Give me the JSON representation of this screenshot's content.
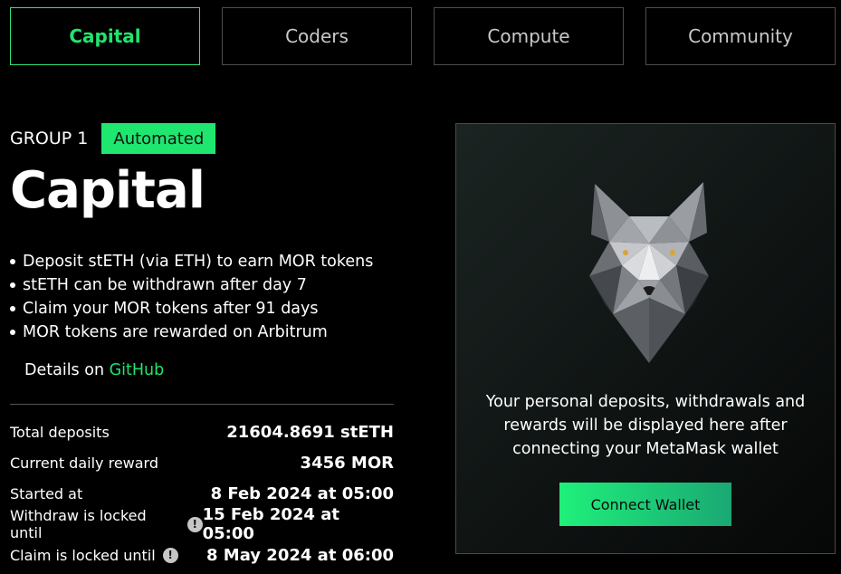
{
  "tabs": [
    {
      "label": "Capital",
      "active": true
    },
    {
      "label": "Coders",
      "active": false
    },
    {
      "label": "Compute",
      "active": false
    },
    {
      "label": "Community",
      "active": false
    }
  ],
  "group": {
    "label": "GROUP 1",
    "badge": "Automated"
  },
  "title": "Capital",
  "bullets": [
    "Deposit stETH (via ETH) to earn MOR tokens",
    "stETH can be withdrawn after day 7",
    "Claim your MOR tokens after 91 days",
    "MOR tokens are rewarded on Arbitrum"
  ],
  "details": {
    "prefix": "Details on",
    "link": "GitHub"
  },
  "stats": [
    {
      "label": "Total deposits",
      "value": "21604.8691 stETH",
      "info": false
    },
    {
      "label": "Current daily reward",
      "value": "3456 MOR",
      "info": false
    },
    {
      "label": "Started at",
      "value": "8 Feb 2024 at 05:00",
      "info": false
    },
    {
      "label": "Withdraw is locked until",
      "value": "15 Feb 2024 at 05:00",
      "info": true
    },
    {
      "label": "Claim is locked until",
      "value": "8 May 2024 at 06:00",
      "info": true
    }
  ],
  "panel": {
    "text": "Your personal deposits, withdrawals and rewards will be displayed here after connecting your MetaMask wallet",
    "button": "Connect Wallet",
    "image": "wolf-logo"
  },
  "colors": {
    "accent": "#1ee66f",
    "background": "#000000",
    "border": "#4d4d4d"
  }
}
